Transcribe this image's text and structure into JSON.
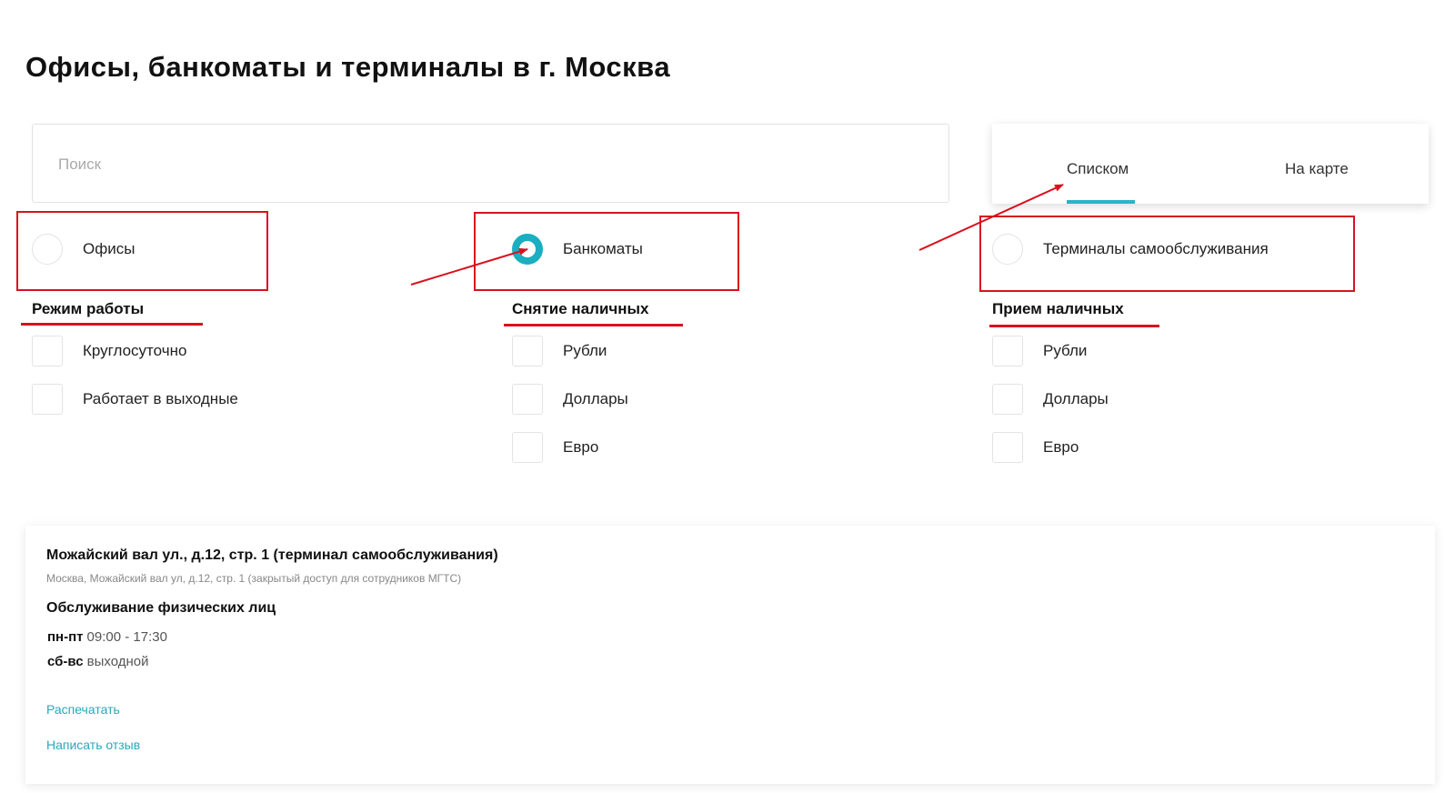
{
  "header": {
    "title": "Офисы, банкоматы и терминалы в г. Москва"
  },
  "search": {
    "placeholder": "Поиск",
    "value": ""
  },
  "view_toggle": {
    "tabs": [
      "Списком",
      "На карте"
    ],
    "active": "Списком"
  },
  "types": {
    "offices": {
      "label": "Офисы",
      "checked": false
    },
    "atms": {
      "label": "Банкоматы",
      "checked": true
    },
    "terminals": {
      "label": "Терминалы самообслуживания",
      "checked": false
    }
  },
  "filters": {
    "work_mode": {
      "title": "Режим работы",
      "options": [
        "Круглосуточно",
        "Работает в выходные"
      ]
    },
    "cash_withdrawal": {
      "title": "Снятие наличных",
      "options": [
        "Рубли",
        "Доллары",
        "Евро"
      ]
    },
    "cash_deposit": {
      "title": "Прием наличных",
      "options": [
        "Рубли",
        "Доллары",
        "Евро"
      ]
    }
  },
  "result_card": {
    "title": "Можайский вал ул., д.12, стр. 1 (терминал самообслуживания)",
    "address": "Москва, Можайский вал ул, д.12, стр. 1 (закрытый доступ для сотрудников МГТС)",
    "service_title": "Обслуживание физических лиц",
    "hours": [
      {
        "days": "пн-пт",
        "time": "09:00 - 17:30"
      },
      {
        "days": "сб-вс",
        "time": "выходной"
      }
    ],
    "links": {
      "print": "Распечатать",
      "review": "Написать отзыв"
    }
  },
  "colors": {
    "accent": "#29b6c6",
    "annotation": "#d9121f",
    "link": "#29a9bb"
  }
}
